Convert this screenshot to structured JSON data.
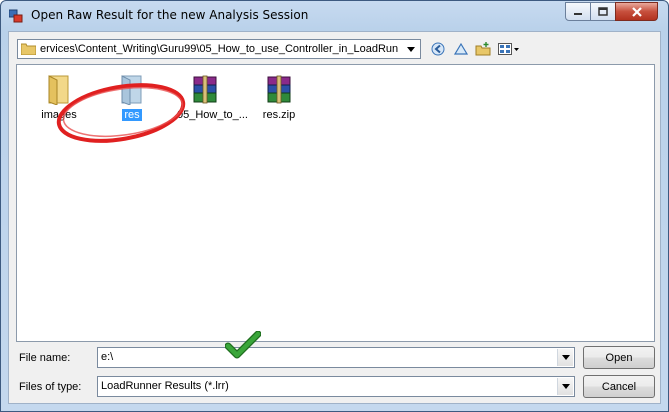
{
  "window": {
    "title": "Open Raw Result for the new Analysis Session"
  },
  "toolbar": {
    "path": "ervices\\Content_Writing\\Guru99\\05_How_to_use_Controller_in_LoadRunner",
    "icons": [
      "back-icon",
      "up-folder-icon",
      "new-folder-icon",
      "view-menu-icon"
    ]
  },
  "files": [
    {
      "name": "images",
      "kind": "folder",
      "selected": false
    },
    {
      "name": "res",
      "kind": "folder",
      "selected": true
    },
    {
      "name": "05_How_to_...",
      "kind": "rar-archive",
      "selected": false
    },
    {
      "name": "res.zip",
      "kind": "rar-archive",
      "selected": false
    }
  ],
  "annotation": {
    "circle_color": "#e02020",
    "check_color": "#3aa63a"
  },
  "form": {
    "file_name_label": "File name:",
    "file_name_value": "e:\\",
    "file_type_label": "Files of type:",
    "file_type_value": "LoadRunner Results (*.lrr)"
  },
  "buttons": {
    "open": "Open",
    "cancel": "Cancel"
  }
}
